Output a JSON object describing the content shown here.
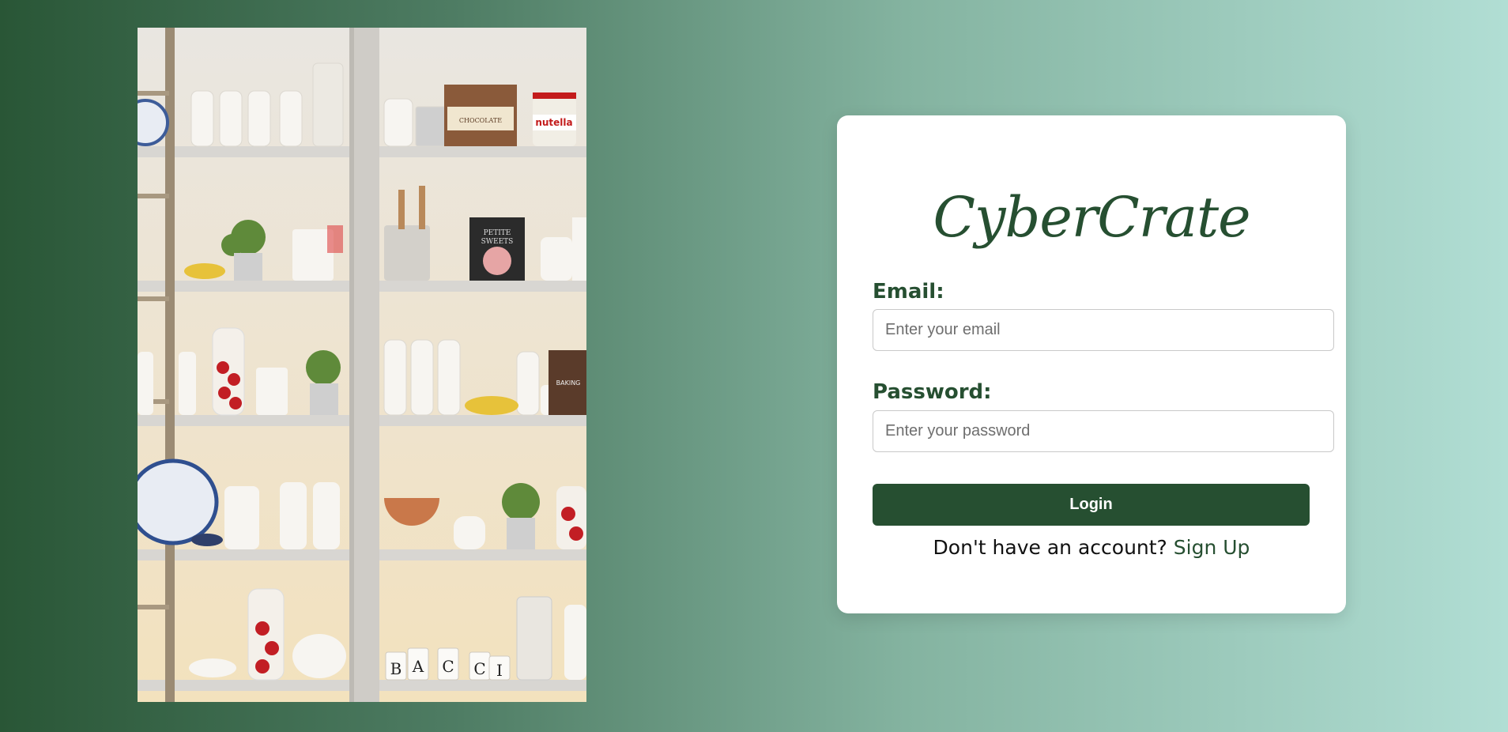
{
  "brand": {
    "name": "CyberCrate"
  },
  "login_form": {
    "email_label": "Email:",
    "email_placeholder": "Enter your email",
    "email_value": "",
    "password_label": "Password:",
    "password_placeholder": "Enter your password",
    "password_value": "",
    "login_button": "Login",
    "signup_prompt": "Don't have an account?",
    "signup_link": "Sign Up"
  },
  "shelf_photo": {
    "visible_text": [
      "nutella",
      "CHOCOLATE",
      "PETITE SWEETS",
      "BAKING",
      "B",
      "A",
      "C",
      "C",
      "I"
    ]
  },
  "colors": {
    "brand_green": "#264f31",
    "bg_gradient_start": "#295636",
    "bg_gradient_end": "#b1ded4",
    "card_bg": "#ffffff"
  }
}
